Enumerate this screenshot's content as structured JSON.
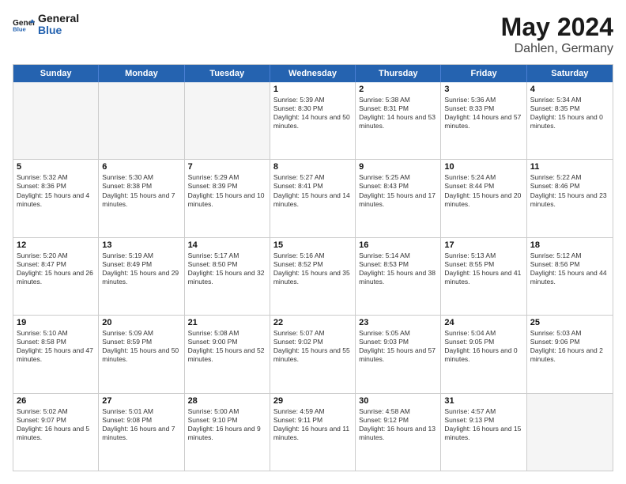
{
  "logo": {
    "text_general": "General",
    "text_blue": "Blue"
  },
  "title": "May 2024",
  "subtitle": "Dahlen, Germany",
  "header_days": [
    "Sunday",
    "Monday",
    "Tuesday",
    "Wednesday",
    "Thursday",
    "Friday",
    "Saturday"
  ],
  "rows": [
    [
      {
        "day": "",
        "empty": true
      },
      {
        "day": "",
        "empty": true
      },
      {
        "day": "",
        "empty": true
      },
      {
        "day": "1",
        "sunrise": "Sunrise: 5:39 AM",
        "sunset": "Sunset: 8:30 PM",
        "daylight": "Daylight: 14 hours and 50 minutes."
      },
      {
        "day": "2",
        "sunrise": "Sunrise: 5:38 AM",
        "sunset": "Sunset: 8:31 PM",
        "daylight": "Daylight: 14 hours and 53 minutes."
      },
      {
        "day": "3",
        "sunrise": "Sunrise: 5:36 AM",
        "sunset": "Sunset: 8:33 PM",
        "daylight": "Daylight: 14 hours and 57 minutes."
      },
      {
        "day": "4",
        "sunrise": "Sunrise: 5:34 AM",
        "sunset": "Sunset: 8:35 PM",
        "daylight": "Daylight: 15 hours and 0 minutes."
      }
    ],
    [
      {
        "day": "5",
        "sunrise": "Sunrise: 5:32 AM",
        "sunset": "Sunset: 8:36 PM",
        "daylight": "Daylight: 15 hours and 4 minutes."
      },
      {
        "day": "6",
        "sunrise": "Sunrise: 5:30 AM",
        "sunset": "Sunset: 8:38 PM",
        "daylight": "Daylight: 15 hours and 7 minutes."
      },
      {
        "day": "7",
        "sunrise": "Sunrise: 5:29 AM",
        "sunset": "Sunset: 8:39 PM",
        "daylight": "Daylight: 15 hours and 10 minutes."
      },
      {
        "day": "8",
        "sunrise": "Sunrise: 5:27 AM",
        "sunset": "Sunset: 8:41 PM",
        "daylight": "Daylight: 15 hours and 14 minutes."
      },
      {
        "day": "9",
        "sunrise": "Sunrise: 5:25 AM",
        "sunset": "Sunset: 8:43 PM",
        "daylight": "Daylight: 15 hours and 17 minutes."
      },
      {
        "day": "10",
        "sunrise": "Sunrise: 5:24 AM",
        "sunset": "Sunset: 8:44 PM",
        "daylight": "Daylight: 15 hours and 20 minutes."
      },
      {
        "day": "11",
        "sunrise": "Sunrise: 5:22 AM",
        "sunset": "Sunset: 8:46 PM",
        "daylight": "Daylight: 15 hours and 23 minutes."
      }
    ],
    [
      {
        "day": "12",
        "sunrise": "Sunrise: 5:20 AM",
        "sunset": "Sunset: 8:47 PM",
        "daylight": "Daylight: 15 hours and 26 minutes."
      },
      {
        "day": "13",
        "sunrise": "Sunrise: 5:19 AM",
        "sunset": "Sunset: 8:49 PM",
        "daylight": "Daylight: 15 hours and 29 minutes."
      },
      {
        "day": "14",
        "sunrise": "Sunrise: 5:17 AM",
        "sunset": "Sunset: 8:50 PM",
        "daylight": "Daylight: 15 hours and 32 minutes."
      },
      {
        "day": "15",
        "sunrise": "Sunrise: 5:16 AM",
        "sunset": "Sunset: 8:52 PM",
        "daylight": "Daylight: 15 hours and 35 minutes."
      },
      {
        "day": "16",
        "sunrise": "Sunrise: 5:14 AM",
        "sunset": "Sunset: 8:53 PM",
        "daylight": "Daylight: 15 hours and 38 minutes."
      },
      {
        "day": "17",
        "sunrise": "Sunrise: 5:13 AM",
        "sunset": "Sunset: 8:55 PM",
        "daylight": "Daylight: 15 hours and 41 minutes."
      },
      {
        "day": "18",
        "sunrise": "Sunrise: 5:12 AM",
        "sunset": "Sunset: 8:56 PM",
        "daylight": "Daylight: 15 hours and 44 minutes."
      }
    ],
    [
      {
        "day": "19",
        "sunrise": "Sunrise: 5:10 AM",
        "sunset": "Sunset: 8:58 PM",
        "daylight": "Daylight: 15 hours and 47 minutes."
      },
      {
        "day": "20",
        "sunrise": "Sunrise: 5:09 AM",
        "sunset": "Sunset: 8:59 PM",
        "daylight": "Daylight: 15 hours and 50 minutes."
      },
      {
        "day": "21",
        "sunrise": "Sunrise: 5:08 AM",
        "sunset": "Sunset: 9:00 PM",
        "daylight": "Daylight: 15 hours and 52 minutes."
      },
      {
        "day": "22",
        "sunrise": "Sunrise: 5:07 AM",
        "sunset": "Sunset: 9:02 PM",
        "daylight": "Daylight: 15 hours and 55 minutes."
      },
      {
        "day": "23",
        "sunrise": "Sunrise: 5:05 AM",
        "sunset": "Sunset: 9:03 PM",
        "daylight": "Daylight: 15 hours and 57 minutes."
      },
      {
        "day": "24",
        "sunrise": "Sunrise: 5:04 AM",
        "sunset": "Sunset: 9:05 PM",
        "daylight": "Daylight: 16 hours and 0 minutes."
      },
      {
        "day": "25",
        "sunrise": "Sunrise: 5:03 AM",
        "sunset": "Sunset: 9:06 PM",
        "daylight": "Daylight: 16 hours and 2 minutes."
      }
    ],
    [
      {
        "day": "26",
        "sunrise": "Sunrise: 5:02 AM",
        "sunset": "Sunset: 9:07 PM",
        "daylight": "Daylight: 16 hours and 5 minutes."
      },
      {
        "day": "27",
        "sunrise": "Sunrise: 5:01 AM",
        "sunset": "Sunset: 9:08 PM",
        "daylight": "Daylight: 16 hours and 7 minutes."
      },
      {
        "day": "28",
        "sunrise": "Sunrise: 5:00 AM",
        "sunset": "Sunset: 9:10 PM",
        "daylight": "Daylight: 16 hours and 9 minutes."
      },
      {
        "day": "29",
        "sunrise": "Sunrise: 4:59 AM",
        "sunset": "Sunset: 9:11 PM",
        "daylight": "Daylight: 16 hours and 11 minutes."
      },
      {
        "day": "30",
        "sunrise": "Sunrise: 4:58 AM",
        "sunset": "Sunset: 9:12 PM",
        "daylight": "Daylight: 16 hours and 13 minutes."
      },
      {
        "day": "31",
        "sunrise": "Sunrise: 4:57 AM",
        "sunset": "Sunset: 9:13 PM",
        "daylight": "Daylight: 16 hours and 15 minutes."
      },
      {
        "day": "",
        "empty": true
      }
    ]
  ],
  "colors": {
    "header_bg": "#2563b0",
    "header_text": "#ffffff",
    "border": "#cccccc",
    "empty_bg": "#f0f0f0",
    "row_shaded_bg": "#f5f5f5"
  }
}
